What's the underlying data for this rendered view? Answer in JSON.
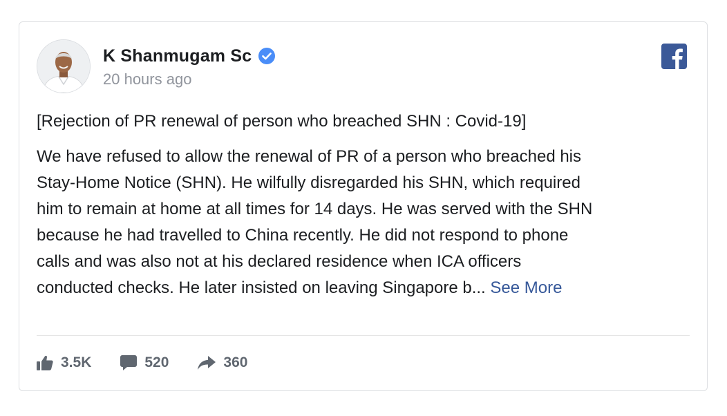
{
  "post": {
    "author": "K Shanmugam Sc",
    "timestamp": "20 hours ago",
    "title": "[Rejection of PR renewal of person who breached SHN : Covid-19]",
    "body_lines": [
      "We have refused to allow the renewal of PR of a person who breached his",
      "Stay-Home Notice (SHN). He wilfully disregarded his SHN, which required",
      "him to remain at home at all times for 14 days. He was served with the SHN",
      "because he had travelled to China recently. He did not respond to phone",
      "calls and was also not at his declared residence when ICA officers",
      "conducted checks. He later insisted on leaving Singapore b..."
    ],
    "see_more": "See More"
  },
  "stats": {
    "likes": "3.5K",
    "comments": "520",
    "shares": "360"
  },
  "icons": {
    "verified": "verified-badge-icon",
    "platform": "facebook-logo-icon",
    "like": "thumbs-up-icon",
    "comment": "comment-bubble-icon",
    "share": "share-arrow-icon"
  },
  "colors": {
    "verified": "#4a8df8",
    "facebook": "#3b5998",
    "link": "#365899",
    "muted": "#90949c",
    "stat_icon": "#606770"
  }
}
